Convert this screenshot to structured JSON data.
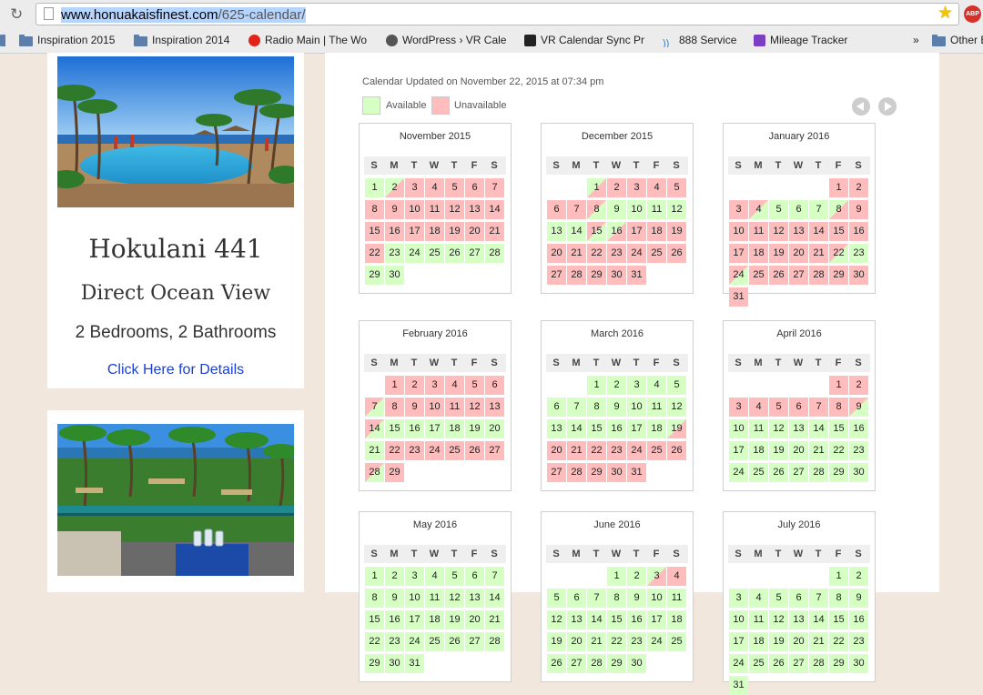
{
  "browser": {
    "url_host": "www.honuakaisfinest.com",
    "url_path": "/625-calendar/",
    "bookmarks": [
      {
        "label": "Inspiration 2015",
        "icon": "folder-icon"
      },
      {
        "label": "Inspiration 2014",
        "icon": "folder-icon"
      },
      {
        "label": "Radio Main | The Wo",
        "icon": "radio-icon"
      },
      {
        "label": "WordPress › VR Cale",
        "icon": "wordpress-icon"
      },
      {
        "label": "VR Calendar Sync Pr",
        "icon": "plugin-icon"
      },
      {
        "label": "888 Service",
        "icon": "signal-icon"
      },
      {
        "label": "Mileage Tracker",
        "icon": "form-icon"
      },
      {
        "label": "»",
        "icon": "overflow-icon"
      },
      {
        "label": "Other B",
        "icon": "folder-icon"
      }
    ],
    "adblock_label": "ABP"
  },
  "colors": {
    "available": "#d6ffc4",
    "unavailable": "#ffbcbc",
    "link": "#1a3fd6"
  },
  "property": {
    "title": "Hokulani 441",
    "subtitle": "Direct Ocean View",
    "rooms": "2 Bedrooms, 2 Bathrooms",
    "link": "Click Here for Details"
  },
  "calendar": {
    "updated": "Calendar Updated on November 22, 2015 at 07:34 pm",
    "legend_available": "Available",
    "legend_unavailable": "Unavailable",
    "weekdays": [
      "S",
      "M",
      "T",
      "W",
      "T",
      "F",
      "S"
    ],
    "months": [
      {
        "name": "November 2015",
        "start": 0,
        "days": 30,
        "status": "aiuuuuuuuuuuuuuuuuuuuuaaaaaaaa"
      },
      {
        "name": "December 2015",
        "start": 2,
        "days": 31,
        "status": "iuuuuuuoaaaaaaoiuuuuuuuuuuuuuuu"
      },
      {
        "name": "January 2016",
        "start": 5,
        "days": 31,
        "status": "uuuoaaaiuuuuuuuuuuuuuoaouuuuuuu"
      },
      {
        "name": "February 2016",
        "start": 1,
        "days": 29,
        "status": "uuuuuuouuuuuuoaaaaaaauuuuuuou"
      },
      {
        "name": "March 2016",
        "start": 2,
        "days": 31,
        "status": "aaaaaaaaaaaaaaaaaaiuuuuuuuuuuuu"
      },
      {
        "name": "April 2016",
        "start": 5,
        "days": 30,
        "status": "uuuuuuuuoaaaaaaaaaaaaaaaaaaaaa"
      },
      {
        "name": "May 2016",
        "start": 0,
        "days": 31,
        "status": "aaaaaaaaaaaaaaaaaaaaaaaaaaaaaaa"
      },
      {
        "name": "June 2016",
        "start": 3,
        "days": 30,
        "status": "aaiuaaaaaaaaaaaaaaaaaaaaaaaaaa"
      },
      {
        "name": "July 2016",
        "start": 5,
        "days": 31,
        "status": "aaaaaaaaaaaaaaaaaaaaaaaaaaaaaaa"
      }
    ]
  }
}
